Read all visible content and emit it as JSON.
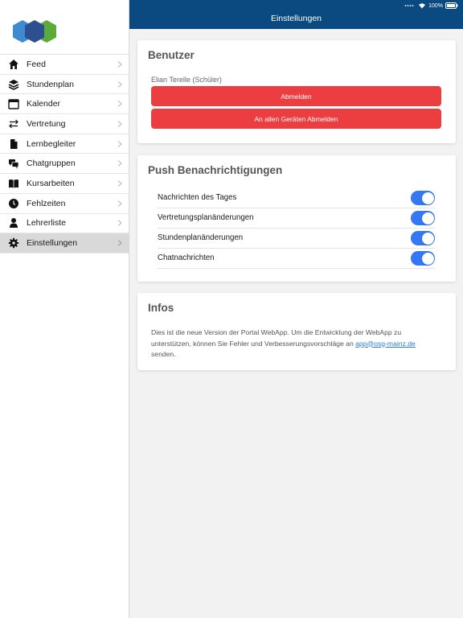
{
  "status_bar": {
    "battery": "100%"
  },
  "header": {
    "title": "Einstellungen"
  },
  "sidebar": {
    "items": [
      {
        "label": "Feed",
        "icon": "home-icon"
      },
      {
        "label": "Stundenplan",
        "icon": "layers-icon"
      },
      {
        "label": "Kalender",
        "icon": "calendar-icon"
      },
      {
        "label": "Vertretung",
        "icon": "swap-icon"
      },
      {
        "label": "Lernbegleiter",
        "icon": "document-icon"
      },
      {
        "label": "Chatgruppen",
        "icon": "chat-icon"
      },
      {
        "label": "Kursarbeiten",
        "icon": "book-icon"
      },
      {
        "label": "Fehlzeiten",
        "icon": "clock-icon"
      },
      {
        "label": "Lehrerliste",
        "icon": "person-icon"
      },
      {
        "label": "Einstellungen",
        "icon": "gear-icon",
        "active": true
      }
    ]
  },
  "benutzer": {
    "title": "Benutzer",
    "user": "Elian Terelle (Schüler)",
    "logout_label": "Abmelden",
    "logout_all_label": "An allen Geräten Abmelden",
    "button_color": "#ec3e40"
  },
  "push": {
    "title": "Push Benachrichtigungen",
    "toggles": [
      {
        "label": "Nachrichten des Tages",
        "on": true
      },
      {
        "label": "Vertretungsplanänderungen",
        "on": true
      },
      {
        "label": "Stundenplanänderungen",
        "on": true
      },
      {
        "label": "Chatnachrichten",
        "on": true
      }
    ],
    "toggle_color": "#3478f6"
  },
  "infos": {
    "title": "Infos",
    "text_before": "Dies ist die neue Version der Portal WebApp. Um die Entwicklung der WebApp zu unterstützen, können Sie Fehler und Verbesserungsvorschläge an ",
    "link": "app@osg-mainz.de",
    "text_after": " senden."
  },
  "colors": {
    "header_bg": "#0b4a80",
    "active_nav_bg": "#d9d9d9"
  }
}
